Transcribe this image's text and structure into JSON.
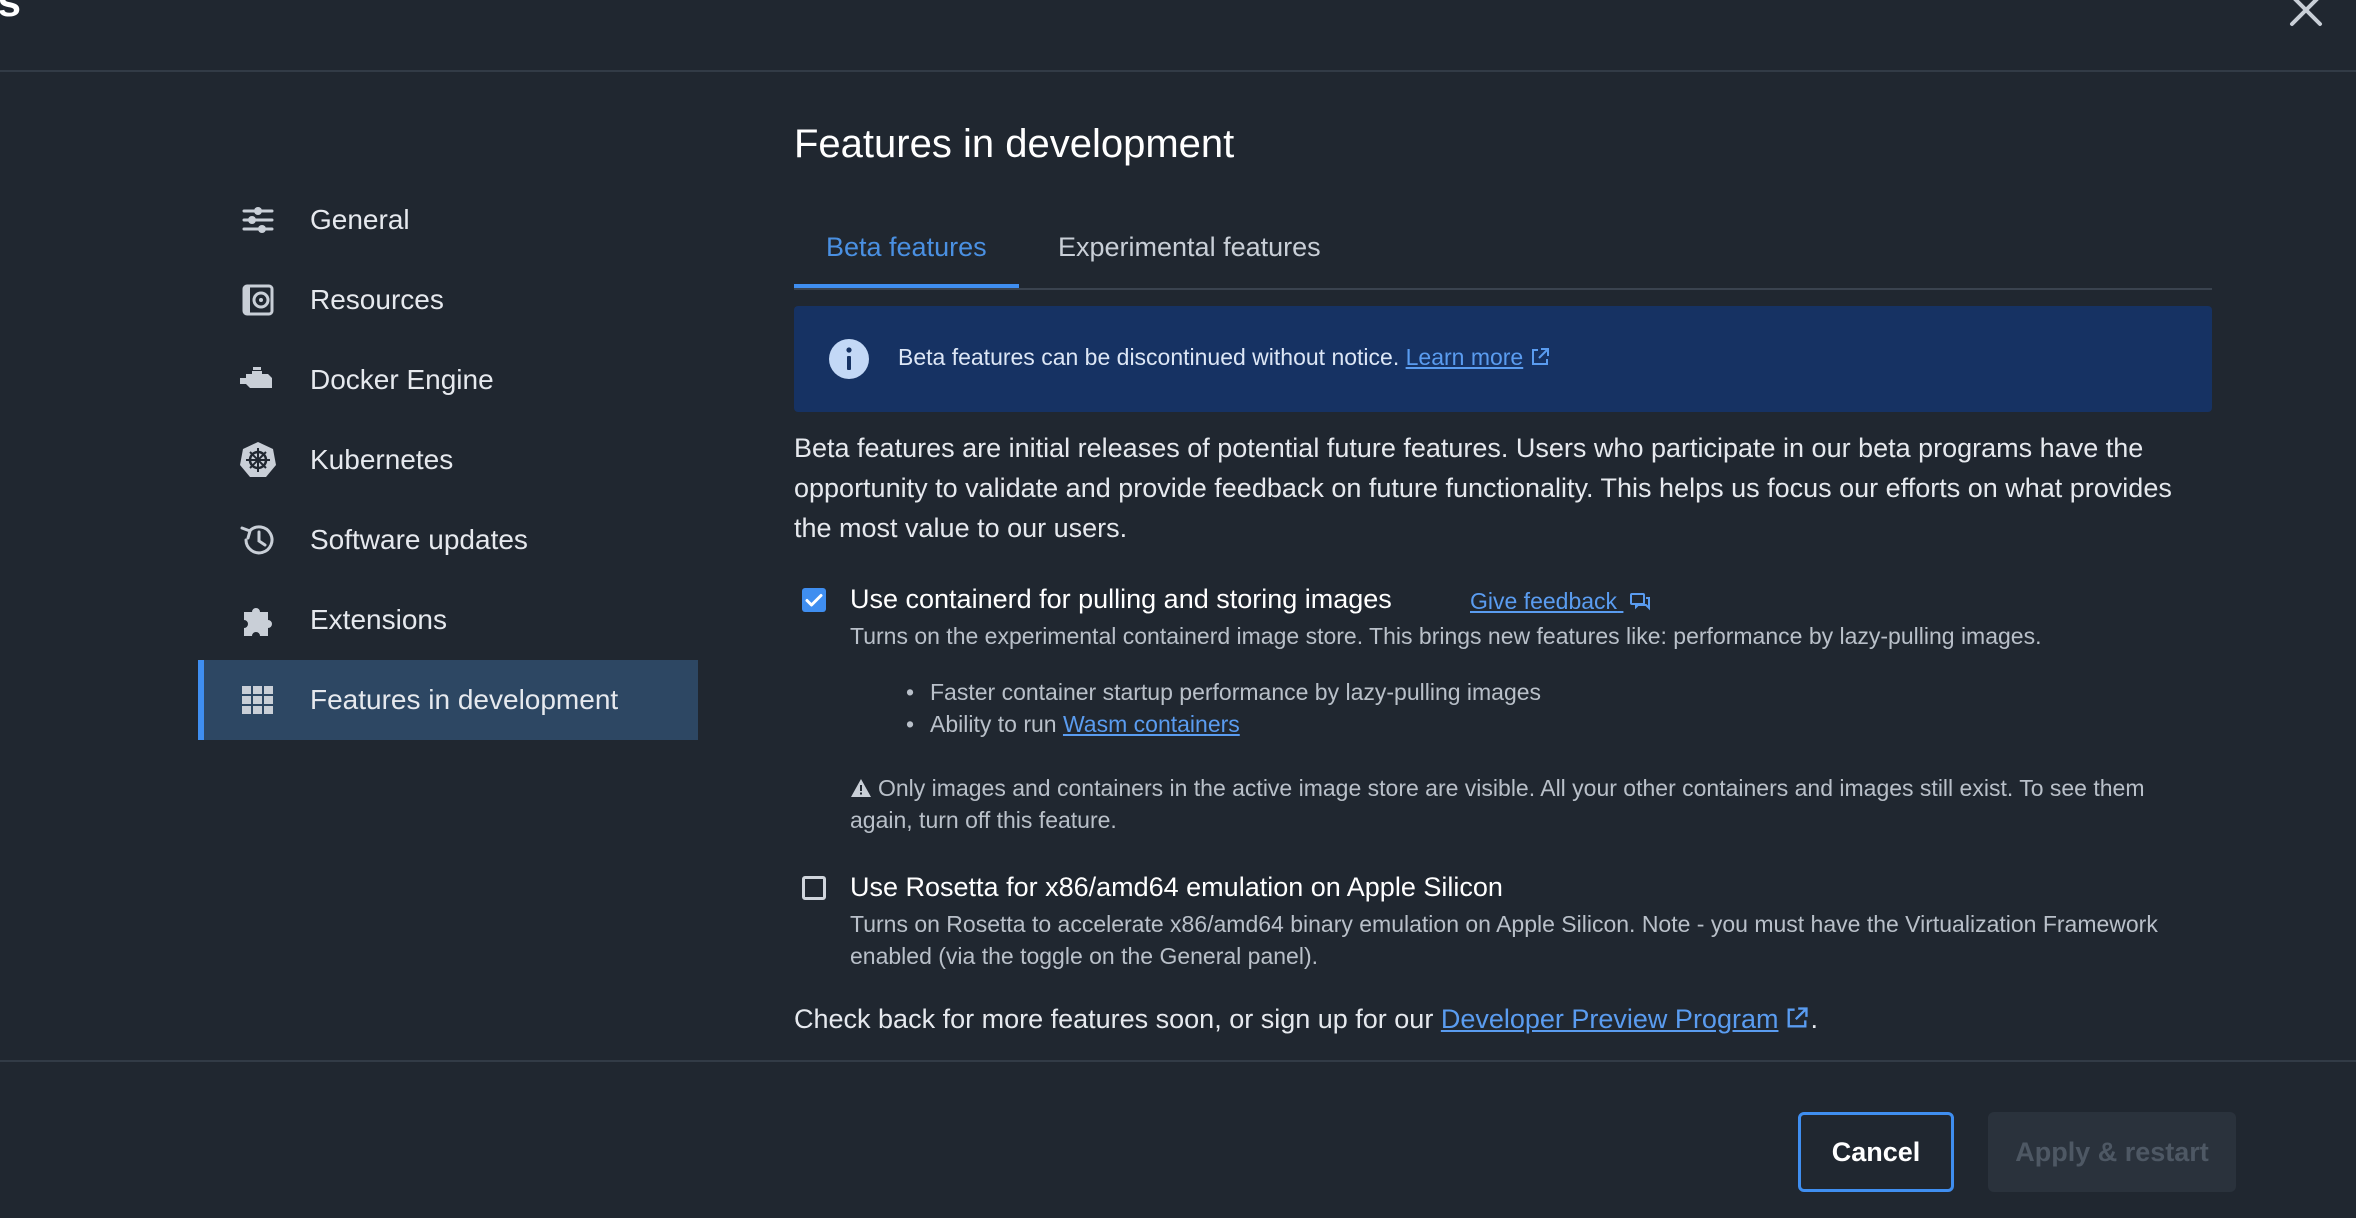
{
  "window": {
    "title": "gs"
  },
  "sidebar": {
    "items": [
      {
        "label": "General",
        "icon": "sliders-icon"
      },
      {
        "label": "Resources",
        "icon": "disk-icon"
      },
      {
        "label": "Docker Engine",
        "icon": "engine-icon"
      },
      {
        "label": "Kubernetes",
        "icon": "kubernetes-helm-icon"
      },
      {
        "label": "Software updates",
        "icon": "history-icon"
      },
      {
        "label": "Extensions",
        "icon": "puzzle-icon"
      },
      {
        "label": "Features in development",
        "icon": "grid-icon",
        "active": true
      }
    ]
  },
  "main": {
    "title": "Features in development",
    "tabs": [
      {
        "label": "Beta features",
        "active": true
      },
      {
        "label": "Experimental features"
      }
    ],
    "banner": {
      "message": "Beta features can be discontinued without notice.",
      "link": "Learn more"
    },
    "description": "Beta features are initial releases of potential future features. Users who participate in our beta programs have the opportunity to validate and provide feedback on future functionality. This helps us focus our efforts on what provides the most value to our users.",
    "features": [
      {
        "title": "Use containerd for pulling and storing images",
        "checked": true,
        "feedback_link": "Give feedback",
        "description": "Turns on the experimental containerd image store. This brings new features like: performance by lazy-pulling images.",
        "bullets": [
          "Faster container startup performance by lazy-pulling images",
          "Ability to run "
        ],
        "bullet_link": "Wasm containers",
        "warning": "Only images and containers in the active image store are visible. All your other containers and images still exist. To see them again, turn off this feature."
      },
      {
        "title": "Use Rosetta for x86/amd64 emulation on Apple Silicon",
        "checked": false,
        "description": "Turns on Rosetta to accelerate x86/amd64 binary emulation on Apple Silicon. Note - you must have the Virtualization Framework enabled (via the toggle on the General panel)."
      }
    ],
    "footer": {
      "text": "Check back for more features soon, or sign up for our ",
      "link": "Developer Preview Program",
      "suffix": "."
    }
  },
  "buttons": {
    "cancel": "Cancel",
    "apply": "Apply & restart"
  },
  "colors": {
    "background": "#202730",
    "accent": "#3f8ef0",
    "banner": "#163263",
    "active_nav": "#2d4763"
  }
}
